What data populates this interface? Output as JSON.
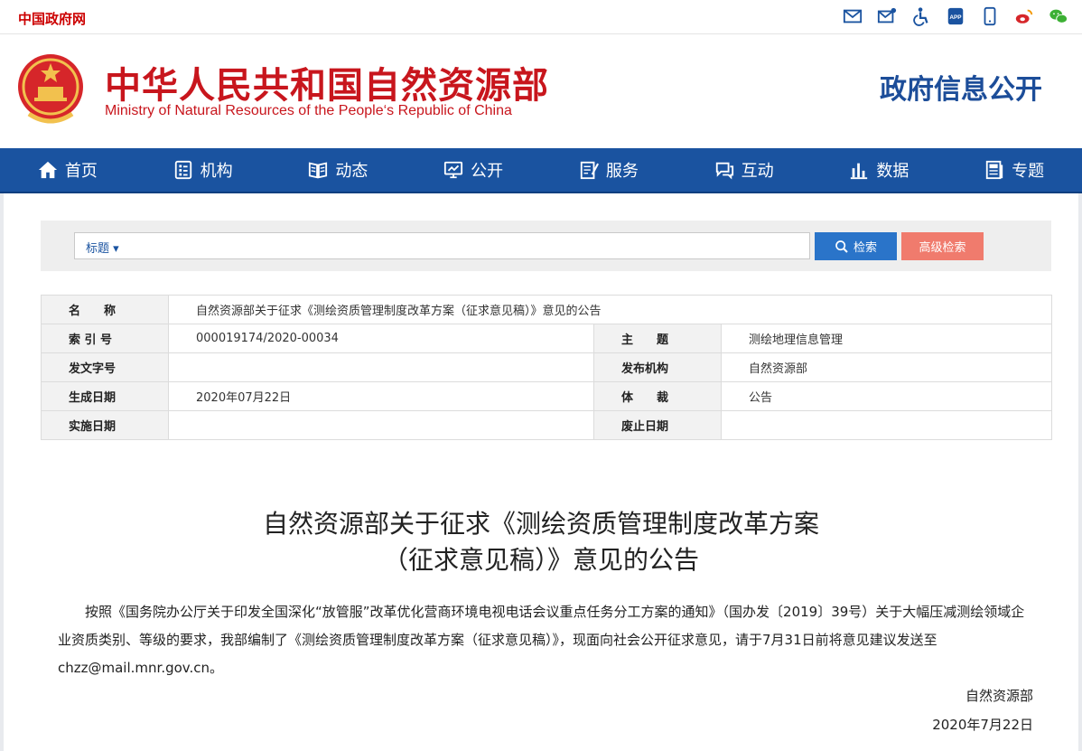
{
  "topbar": {
    "site_name": "中国政府网"
  },
  "top_icons": [
    "mail-icon",
    "mail-edit-icon",
    "accessibility-icon",
    "app-icon",
    "mobile-icon",
    "weibo-icon",
    "wechat-icon"
  ],
  "header": {
    "ministry_cn": "中华人民共和国自然资源部",
    "ministry_en": "Ministry of Natural Resources of the People‘s Republic of China",
    "gov_info": "政府信息公开"
  },
  "nav": [
    {
      "label": "首页",
      "icon": "home-icon"
    },
    {
      "label": "机构",
      "icon": "org-icon"
    },
    {
      "label": "动态",
      "icon": "book-icon"
    },
    {
      "label": "公开",
      "icon": "monitor-icon"
    },
    {
      "label": "服务",
      "icon": "edit-doc-icon"
    },
    {
      "label": "互动",
      "icon": "chat-icon"
    },
    {
      "label": "数据",
      "icon": "bar-chart-icon"
    },
    {
      "label": "专题",
      "icon": "topic-icon"
    }
  ],
  "search": {
    "field_select": "标题 ▾",
    "value": "",
    "search_label": "检索",
    "advanced_label": "高级检索"
  },
  "meta": {
    "name_label": "名　　称",
    "name_value": "自然资源部关于征求《测绘资质管理制度改革方案（征求意见稿）》意见的公告",
    "index_label": "索 引 号",
    "index_value": "000019174/2020-00034",
    "topic_label": "主　　题",
    "topic_value": "测绘地理信息管理",
    "docno_label": "发文字号",
    "docno_value": "",
    "issuer_label": "发布机构",
    "issuer_value": "自然资源部",
    "date_label": "生成日期",
    "date_value": "2020年07月22日",
    "genre_label": "体　　裁",
    "genre_value": "公告",
    "impl_label": "实施日期",
    "impl_value": "",
    "abolish_label": "废止日期",
    "abolish_value": ""
  },
  "document": {
    "title_line1": "自然资源部关于征求《测绘资质管理制度改革方案",
    "title_line2": "（征求意见稿）》意见的公告",
    "body": "按照《国务院办公厅关于印发全国深化“放管服”改革优化营商环境电视电话会议重点任务分工方案的通知》（国办发〔2019〕39号）关于大幅压减测绘领域企业资质类别、等级的要求，我部编制了《测绘资质管理制度改革方案（征求意见稿）》，现面向社会公开征求意见，请于7月31日前将意见建议发送至chzz@mail.mnr.gov.cn。",
    "signature": "自然资源部",
    "sign_date": "2020年7月22日"
  },
  "colors": {
    "brand_red": "#c8161d",
    "nav_blue": "#1a53a0",
    "search_blue": "#2a74c9",
    "advanced_red": "#f07b6d"
  }
}
